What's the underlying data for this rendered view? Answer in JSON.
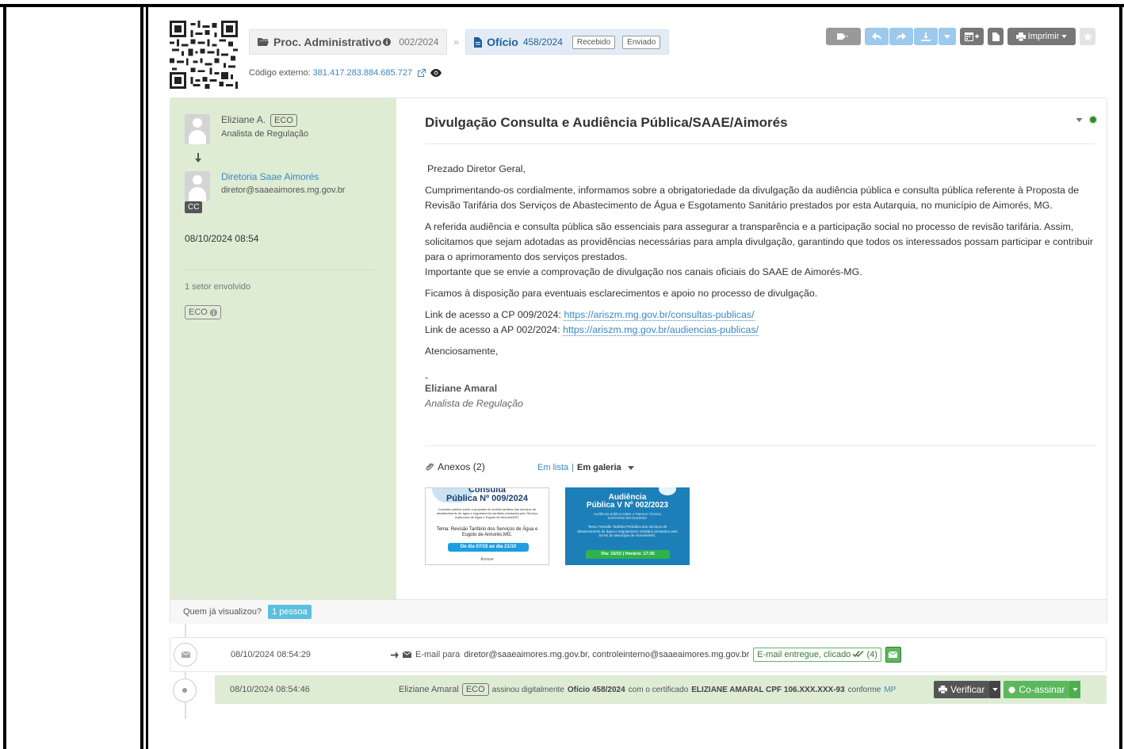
{
  "breadcrumb": {
    "proc_title": "Proc. Administrativo",
    "proc_number": "002/2024",
    "separator": "»",
    "doc_title": "Ofício",
    "doc_number": "458/2024",
    "tag_received": "Recebido",
    "tag_sent": "Enviado"
  },
  "external_code": {
    "label": "Código externo:",
    "value": "381.417.283.884.685.727"
  },
  "toolbar": {
    "print_label": "Imprimir"
  },
  "sender": {
    "name": "Eliziane A.",
    "org": "ECO",
    "role": "Analista de Regulação"
  },
  "recipient": {
    "name": "Diretoria Saae Aimorés",
    "email": "diretor@saaeaimores.mg.gov.br",
    "cc_label": "CC"
  },
  "sidebar": {
    "date": "08/10/2024 08:54",
    "sectors": "1 setor envolvido",
    "sector_tag": "ECO"
  },
  "message": {
    "subject": "Divulgação Consulta e Audiência Pública/SAAE/Aimorés",
    "greeting": "Prezado Diretor Geral,",
    "p1": "Cumprimentando-os cordialmente, informamos sobre a obrigatoriedade da divulgação da audiência pública e consulta pública referente à Proposta de Revisão Tarifária dos Serviços de Abastecimento de Água e Esgotamento Sanitário prestados por esta Autarquia, no município de Aimorés, MG.",
    "p2": "A referida audiência e consulta pública são essenciais para assegurar a transparência e a participação social no processo de revisão tarifária. Assim, solicitamos que sejam adotadas as providências necessárias para ampla divulgação, garantindo que todos os interessados possam participar e contribuir para o aprimoramento dos serviços prestados.",
    "p3": "Importante que se envie a comprovação de divulgação nos canais oficiais do SAAE de Aimorés-MG.",
    "p4": "Ficamos à disposição para eventuais esclarecimentos e apoio no processo de divulgação.",
    "link1_label": "Link de acesso a CP 009/2024:",
    "link1_url": "https://ariszm.mg.gov.br/consultas-publicas/",
    "link2_label": "Link de acesso a AP 002/2024:",
    "link2_url": "https://ariszm.mg.gov.br/audiencias-publicas/",
    "closing": "Atenciosamente,",
    "dash": "-",
    "sig_name": "Eliziane Amaral",
    "sig_role": "Analista de Regulação"
  },
  "attachments": {
    "title": "Anexos (2)",
    "view_list": "Em lista",
    "view_gallery": "Em galeria",
    "pipe": "|",
    "thumb1": {
      "top": "Consulta",
      "title": "Pública Nº 009/2024",
      "desc": "Consulta pública sobre a proposta de revisão tarifária dos serviços de abastecimento de água e esgotamento sanitário prestados pelo Serviço Autônomo de Água e Esgoto de Aimorés/MG.",
      "tema": "Tema: Revisão Tarifário dos Serviços de Água e Esgoto de Aimorés,MG.",
      "dates": "De dia 07/10 ao dia 21/10",
      "footer": "Acesse"
    },
    "thumb2": {
      "title1": "Audiência",
      "title2": "Pública V Nº 002/2023",
      "desc": "Audiência pública sobre o Parecer Técnico DAF/ARIS-ZM 013/2024",
      "tema": "Tema: Revisão Tarifária Periódica dos serviços de abastecimento de água e esgotamento sanitário prestados pelo SAAE do Município de Aimorés/MG.",
      "dates": "Dia: 15/10 | Horário: 17:30"
    }
  },
  "viewed": {
    "label": "Quem já visualizou?",
    "badge": "1 pessoa"
  },
  "timeline": [
    {
      "date": "08/10/2024 08:54:29",
      "prefix": "E-mail para",
      "recipients": "diretor@saaeaimores.mg.gov.br, controleinterno@saaeaimores.mg.gov.br",
      "status": "E-mail entregue, clicado",
      "count": "(4)"
    },
    {
      "date": "08/10/2024 08:54:46",
      "actor": "Eliziane Amaral",
      "org": "ECO",
      "text1": "assinou digitalmente",
      "doc": "Ofício 458/2024",
      "text2": "com o certificado",
      "cert": "ELIZIANE AMARAL CPF 106.XXX.XXX-93",
      "text3": "conforme",
      "mp": "MP",
      "verify_label": "Verificar",
      "cosign_label": "Co-assinar"
    }
  ]
}
